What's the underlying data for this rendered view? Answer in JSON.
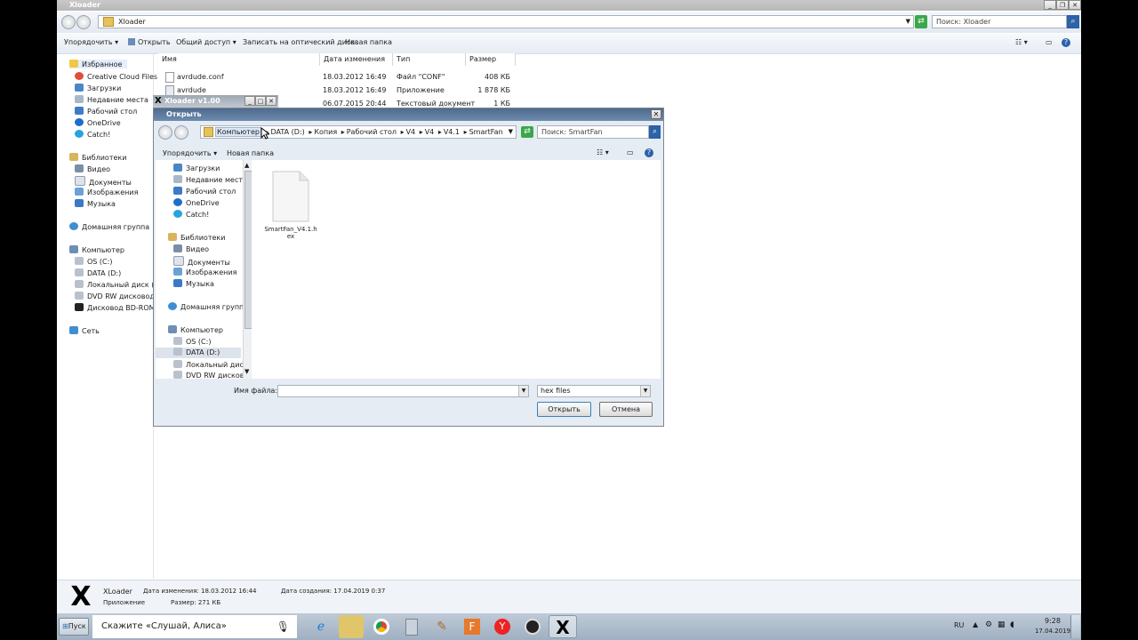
{
  "explorer": {
    "title": "Xloader",
    "address": "Xloader",
    "search_placeholder": "Поиск: Xloader",
    "toolbar": {
      "organize": "Упорядочить",
      "open": "Открыть",
      "share": "Общий доступ",
      "burn": "Записать на оптический диск",
      "new_folder": "Новая папка"
    },
    "nav": {
      "favorites": "Избранное",
      "fav_items": [
        "Creative Cloud Files",
        "Загрузки",
        "Недавние места",
        "Рабочий стол",
        "OneDrive",
        "Catch!"
      ],
      "libraries": "Библиотеки",
      "lib_items": [
        "Видео",
        "Документы",
        "Изображения",
        "Музыка"
      ],
      "homegroup": "Домашняя группа",
      "computer": "Компьютер",
      "comp_items": [
        "OS (C:)",
        "DATA (D:)",
        "Локальный диск (E:)",
        "DVD RW дисковод (F",
        "Дисковод BD-ROM (H"
      ],
      "network": "Сеть"
    },
    "columns": {
      "name": "Имя",
      "date": "Дата изменения",
      "type": "Тип",
      "size": "Размер"
    },
    "files": [
      {
        "name": "avrdude.conf",
        "date": "18.03.2012 16:49",
        "type": "Файл \"CONF\"",
        "size": "408 КБ"
      },
      {
        "name": "avrdude",
        "date": "18.03.2012 16:49",
        "type": "Приложение",
        "size": "1 878 КБ"
      },
      {
        "name": "",
        "date": "06.07.2015 20:44",
        "type": "Текстовый документ",
        "size": "1 КБ"
      }
    ],
    "details": {
      "name": "XLoader",
      "kind": "Приложение",
      "modified_label": "Дата изменения: 18.03.2012 16:44",
      "created_label": "Дата создания: 17.04.2019 0:37",
      "size_label": "Размер: 271 КБ"
    }
  },
  "xloader_window": {
    "title": "Xloader v1.00"
  },
  "dialog": {
    "title": "Открыть",
    "breadcrumb": [
      "Компьютер",
      "DATA (D:)",
      "Копия",
      "Рабочий стол",
      "V4",
      "V4",
      "V4.1",
      "SmartFan"
    ],
    "search_placeholder": "Поиск: SmartFan",
    "toolbar": {
      "organize": "Упорядочить",
      "new_folder": "Новая папка"
    },
    "nav": {
      "fav_items": [
        "Загрузки",
        "Недавние места",
        "Рабочий стол",
        "OneDrive",
        "Catch!"
      ],
      "libraries": "Библиотеки",
      "lib_items": [
        "Видео",
        "Документы",
        "Изображения",
        "Музыка"
      ],
      "homegroup": "Домашняя группа",
      "computer": "Компьютер",
      "comp_items": [
        "OS (C:)",
        "DATA (D:)",
        "Локальный диск (",
        "DVD RW дисковод"
      ]
    },
    "file": {
      "name": "SmartFan_V4.1.hex"
    },
    "filename_label": "Имя файла:",
    "filename_value": "",
    "filter": "hex files",
    "open_button": "Открыть",
    "cancel_button": "Отмена"
  },
  "taskbar": {
    "start": "Пуск",
    "search_text": "Скажите «Слушай, Алиса»",
    "lang": "RU",
    "time": "9:28",
    "date": "17.04.2019"
  }
}
